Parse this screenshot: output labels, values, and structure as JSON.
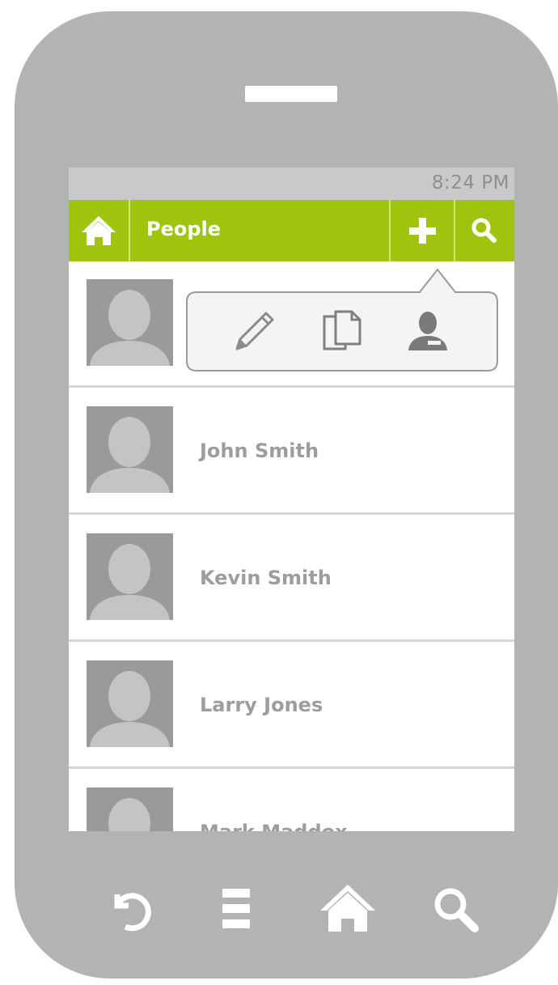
{
  "status_bar": {
    "time": "8:24 PM"
  },
  "action_bar": {
    "title": "People",
    "home_icon": "home-icon",
    "add_icon": "plus-icon",
    "search_icon": "search-icon",
    "accent_color": "#a0c30e"
  },
  "quick_actions": {
    "items": [
      {
        "icon": "pencil-icon"
      },
      {
        "icon": "copy-icon"
      },
      {
        "icon": "contact-icon"
      }
    ]
  },
  "contacts": [
    {
      "name": ""
    },
    {
      "name": "John Smith"
    },
    {
      "name": "Kevin Smith"
    },
    {
      "name": "Larry Jones"
    },
    {
      "name": "Mark Maddox"
    }
  ],
  "nav_bar": {
    "items": [
      {
        "icon": "back-icon"
      },
      {
        "icon": "menu-icon"
      },
      {
        "icon": "home-icon"
      },
      {
        "icon": "search-icon"
      }
    ]
  }
}
